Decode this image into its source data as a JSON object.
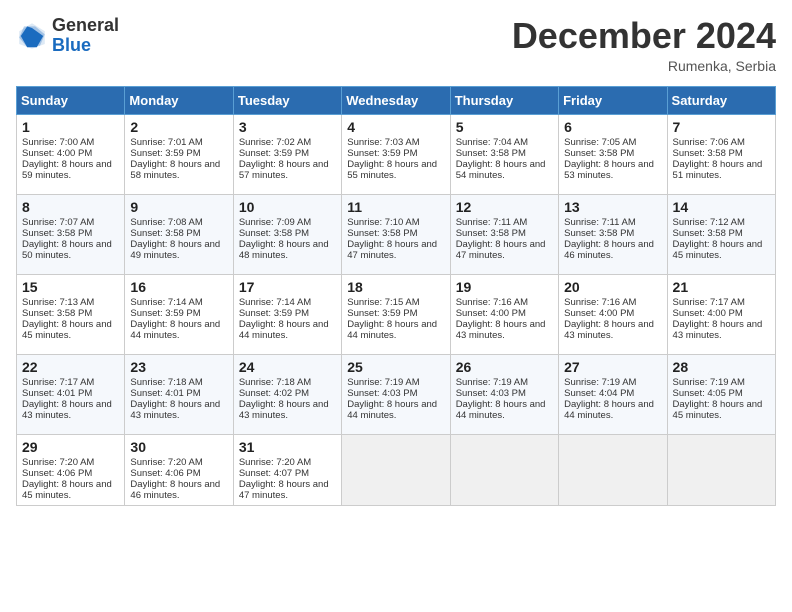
{
  "header": {
    "logo_general": "General",
    "logo_blue": "Blue",
    "month_title": "December 2024",
    "location": "Rumenka, Serbia"
  },
  "days_of_week": [
    "Sunday",
    "Monday",
    "Tuesday",
    "Wednesday",
    "Thursday",
    "Friday",
    "Saturday"
  ],
  "weeks": [
    [
      {
        "day": "1",
        "sunrise": "Sunrise: 7:00 AM",
        "sunset": "Sunset: 4:00 PM",
        "daylight": "Daylight: 8 hours and 59 minutes."
      },
      {
        "day": "2",
        "sunrise": "Sunrise: 7:01 AM",
        "sunset": "Sunset: 3:59 PM",
        "daylight": "Daylight: 8 hours and 58 minutes."
      },
      {
        "day": "3",
        "sunrise": "Sunrise: 7:02 AM",
        "sunset": "Sunset: 3:59 PM",
        "daylight": "Daylight: 8 hours and 57 minutes."
      },
      {
        "day": "4",
        "sunrise": "Sunrise: 7:03 AM",
        "sunset": "Sunset: 3:59 PM",
        "daylight": "Daylight: 8 hours and 55 minutes."
      },
      {
        "day": "5",
        "sunrise": "Sunrise: 7:04 AM",
        "sunset": "Sunset: 3:58 PM",
        "daylight": "Daylight: 8 hours and 54 minutes."
      },
      {
        "day": "6",
        "sunrise": "Sunrise: 7:05 AM",
        "sunset": "Sunset: 3:58 PM",
        "daylight": "Daylight: 8 hours and 53 minutes."
      },
      {
        "day": "7",
        "sunrise": "Sunrise: 7:06 AM",
        "sunset": "Sunset: 3:58 PM",
        "daylight": "Daylight: 8 hours and 51 minutes."
      }
    ],
    [
      {
        "day": "8",
        "sunrise": "Sunrise: 7:07 AM",
        "sunset": "Sunset: 3:58 PM",
        "daylight": "Daylight: 8 hours and 50 minutes."
      },
      {
        "day": "9",
        "sunrise": "Sunrise: 7:08 AM",
        "sunset": "Sunset: 3:58 PM",
        "daylight": "Daylight: 8 hours and 49 minutes."
      },
      {
        "day": "10",
        "sunrise": "Sunrise: 7:09 AM",
        "sunset": "Sunset: 3:58 PM",
        "daylight": "Daylight: 8 hours and 48 minutes."
      },
      {
        "day": "11",
        "sunrise": "Sunrise: 7:10 AM",
        "sunset": "Sunset: 3:58 PM",
        "daylight": "Daylight: 8 hours and 47 minutes."
      },
      {
        "day": "12",
        "sunrise": "Sunrise: 7:11 AM",
        "sunset": "Sunset: 3:58 PM",
        "daylight": "Daylight: 8 hours and 47 minutes."
      },
      {
        "day": "13",
        "sunrise": "Sunrise: 7:11 AM",
        "sunset": "Sunset: 3:58 PM",
        "daylight": "Daylight: 8 hours and 46 minutes."
      },
      {
        "day": "14",
        "sunrise": "Sunrise: 7:12 AM",
        "sunset": "Sunset: 3:58 PM",
        "daylight": "Daylight: 8 hours and 45 minutes."
      }
    ],
    [
      {
        "day": "15",
        "sunrise": "Sunrise: 7:13 AM",
        "sunset": "Sunset: 3:58 PM",
        "daylight": "Daylight: 8 hours and 45 minutes."
      },
      {
        "day": "16",
        "sunrise": "Sunrise: 7:14 AM",
        "sunset": "Sunset: 3:59 PM",
        "daylight": "Daylight: 8 hours and 44 minutes."
      },
      {
        "day": "17",
        "sunrise": "Sunrise: 7:14 AM",
        "sunset": "Sunset: 3:59 PM",
        "daylight": "Daylight: 8 hours and 44 minutes."
      },
      {
        "day": "18",
        "sunrise": "Sunrise: 7:15 AM",
        "sunset": "Sunset: 3:59 PM",
        "daylight": "Daylight: 8 hours and 44 minutes."
      },
      {
        "day": "19",
        "sunrise": "Sunrise: 7:16 AM",
        "sunset": "Sunset: 4:00 PM",
        "daylight": "Daylight: 8 hours and 43 minutes."
      },
      {
        "day": "20",
        "sunrise": "Sunrise: 7:16 AM",
        "sunset": "Sunset: 4:00 PM",
        "daylight": "Daylight: 8 hours and 43 minutes."
      },
      {
        "day": "21",
        "sunrise": "Sunrise: 7:17 AM",
        "sunset": "Sunset: 4:00 PM",
        "daylight": "Daylight: 8 hours and 43 minutes."
      }
    ],
    [
      {
        "day": "22",
        "sunrise": "Sunrise: 7:17 AM",
        "sunset": "Sunset: 4:01 PM",
        "daylight": "Daylight: 8 hours and 43 minutes."
      },
      {
        "day": "23",
        "sunrise": "Sunrise: 7:18 AM",
        "sunset": "Sunset: 4:01 PM",
        "daylight": "Daylight: 8 hours and 43 minutes."
      },
      {
        "day": "24",
        "sunrise": "Sunrise: 7:18 AM",
        "sunset": "Sunset: 4:02 PM",
        "daylight": "Daylight: 8 hours and 43 minutes."
      },
      {
        "day": "25",
        "sunrise": "Sunrise: 7:19 AM",
        "sunset": "Sunset: 4:03 PM",
        "daylight": "Daylight: 8 hours and 44 minutes."
      },
      {
        "day": "26",
        "sunrise": "Sunrise: 7:19 AM",
        "sunset": "Sunset: 4:03 PM",
        "daylight": "Daylight: 8 hours and 44 minutes."
      },
      {
        "day": "27",
        "sunrise": "Sunrise: 7:19 AM",
        "sunset": "Sunset: 4:04 PM",
        "daylight": "Daylight: 8 hours and 44 minutes."
      },
      {
        "day": "28",
        "sunrise": "Sunrise: 7:19 AM",
        "sunset": "Sunset: 4:05 PM",
        "daylight": "Daylight: 8 hours and 45 minutes."
      }
    ],
    [
      {
        "day": "29",
        "sunrise": "Sunrise: 7:20 AM",
        "sunset": "Sunset: 4:06 PM",
        "daylight": "Daylight: 8 hours and 45 minutes."
      },
      {
        "day": "30",
        "sunrise": "Sunrise: 7:20 AM",
        "sunset": "Sunset: 4:06 PM",
        "daylight": "Daylight: 8 hours and 46 minutes."
      },
      {
        "day": "31",
        "sunrise": "Sunrise: 7:20 AM",
        "sunset": "Sunset: 4:07 PM",
        "daylight": "Daylight: 8 hours and 47 minutes."
      },
      null,
      null,
      null,
      null
    ]
  ]
}
